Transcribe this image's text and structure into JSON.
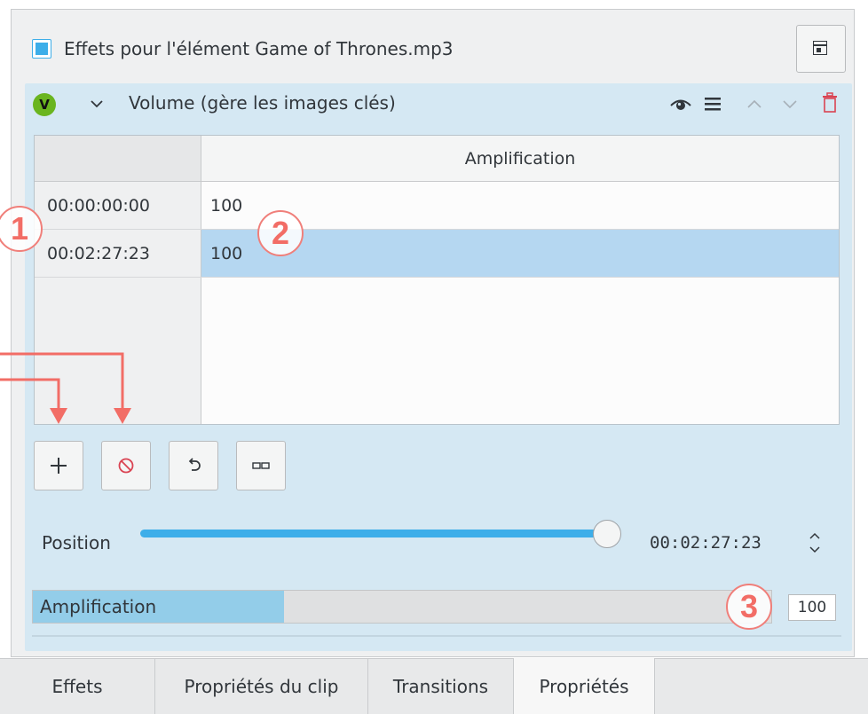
{
  "header": {
    "title": "Effets pour l'élément Game of Thrones.mp3"
  },
  "effect": {
    "badge": "V",
    "name": "Volume (gère les images clés)"
  },
  "keyframe_table": {
    "column_header": "Amplification",
    "rows": [
      {
        "time": "00:00:00:00",
        "value": "100",
        "selected": false
      },
      {
        "time": "00:02:27:23",
        "value": "100",
        "selected": true
      }
    ]
  },
  "position": {
    "label": "Position",
    "time": "00:02:27:23",
    "level": 1.0
  },
  "amplification": {
    "label": "Amplification",
    "value": "100",
    "fill_fraction": 0.34
  },
  "tabs": [
    {
      "label": "Effets",
      "active": false
    },
    {
      "label": "Propriétés du clip",
      "active": false
    },
    {
      "label": "Transitions",
      "active": false
    },
    {
      "label": "Propriétés",
      "active": true
    }
  ],
  "annotations": [
    "1",
    "2",
    "3"
  ],
  "colors": {
    "accent": "#3daee9",
    "effect_bg": "#d5e8f3",
    "selection": "#b5d7f1",
    "annotation": "#f26d66",
    "delete_icon": "#da4453"
  },
  "icons": [
    "layout-icon",
    "collapse-chevron-icon",
    "eye-icon",
    "hamburger-menu-icon",
    "chevron-up-icon",
    "chevron-down-icon",
    "trash-icon",
    "plus-icon",
    "no-entry-icon",
    "undo-icon",
    "link-icon",
    "spin-arrows-icon"
  ]
}
